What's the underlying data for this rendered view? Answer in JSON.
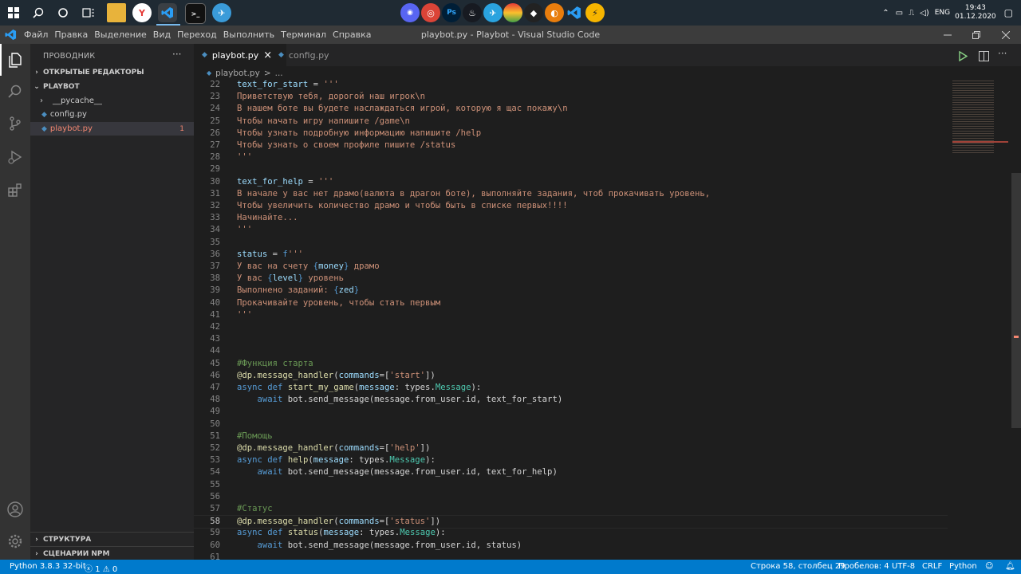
{
  "taskbar": {
    "clock_time": "19:43",
    "clock_date": "01.12.2020",
    "language": "ENG"
  },
  "window": {
    "title": "playbot.py - Playbot - Visual Studio Code",
    "menu": [
      "Файл",
      "Правка",
      "Выделение",
      "Вид",
      "Переход",
      "Выполнить",
      "Терминал",
      "Справка"
    ]
  },
  "sidebar": {
    "title": "ПРОВОДНИК",
    "more": "···",
    "open_editors": "ОТКРЫТЫЕ РЕДАКТОРЫ",
    "project": "PLAYBOT",
    "items": [
      {
        "label": "__pycache__"
      },
      {
        "label": "config.py"
      },
      {
        "label": "playbot.py",
        "badge": "1"
      }
    ],
    "outline": "СТРУКТУРА",
    "npm": "СЦЕНАРИИ NPM"
  },
  "tabs": [
    {
      "label": "playbot.py",
      "close": "×"
    },
    {
      "label": "config.py"
    }
  ],
  "breadcrumb": {
    "file": "playbot.py",
    "sep": ">",
    "rest": "..."
  },
  "editor": {
    "lines": [
      {
        "n": "22",
        "t": [
          [
            "v",
            "text_for_start"
          ],
          [
            "p",
            " = "
          ],
          [
            "s",
            "'''"
          ]
        ]
      },
      {
        "n": "23",
        "t": [
          [
            "s",
            "Приветствую тебя, дорогой наш игрок\\n"
          ]
        ]
      },
      {
        "n": "24",
        "t": [
          [
            "s",
            "В нашем боте вы будете наслаждаться игрой, которую я щас покажу\\n"
          ]
        ]
      },
      {
        "n": "25",
        "t": [
          [
            "s",
            "Чтобы начать игру напишите /game\\n"
          ]
        ]
      },
      {
        "n": "26",
        "t": [
          [
            "s",
            "Чтобы узнать подробную информацию напишите /help"
          ]
        ]
      },
      {
        "n": "27",
        "t": [
          [
            "s",
            "Чтобы узнать о своем профиле пишите /status"
          ]
        ]
      },
      {
        "n": "28",
        "t": [
          [
            "s",
            "'''"
          ]
        ]
      },
      {
        "n": "29",
        "t": []
      },
      {
        "n": "30",
        "t": [
          [
            "v",
            "text_for_help"
          ],
          [
            "p",
            " = "
          ],
          [
            "s",
            "'''"
          ]
        ]
      },
      {
        "n": "31",
        "t": [
          [
            "s",
            "В начале у вас нет драмо(валюта в драгон боте), выполняйте задания, чтоб прокачивать уровень,"
          ]
        ]
      },
      {
        "n": "32",
        "t": [
          [
            "s",
            "Чтобы увеличить количество драмо и чтобы быть в списке первых!!!!"
          ]
        ]
      },
      {
        "n": "33",
        "t": [
          [
            "s",
            "Начинайте..."
          ]
        ]
      },
      {
        "n": "34",
        "t": [
          [
            "s",
            "'''"
          ]
        ]
      },
      {
        "n": "35",
        "t": []
      },
      {
        "n": "36",
        "t": [
          [
            "v",
            "status"
          ],
          [
            "p",
            " = "
          ],
          [
            "k",
            "f"
          ],
          [
            "s",
            "'''"
          ]
        ]
      },
      {
        "n": "37",
        "t": [
          [
            "s",
            "У вас на счету "
          ],
          [
            "k",
            "{"
          ],
          [
            "v",
            "money"
          ],
          [
            "k",
            "}"
          ],
          [
            "s",
            " драмо"
          ]
        ]
      },
      {
        "n": "38",
        "t": [
          [
            "s",
            "У вас "
          ],
          [
            "k",
            "{"
          ],
          [
            "v",
            "level"
          ],
          [
            "k",
            "}"
          ],
          [
            "s",
            " уровень"
          ]
        ]
      },
      {
        "n": "39",
        "t": [
          [
            "s",
            "Выполнено заданий: "
          ],
          [
            "k",
            "{"
          ],
          [
            "v",
            "zed"
          ],
          [
            "k",
            "}"
          ]
        ]
      },
      {
        "n": "40",
        "t": [
          [
            "s",
            "Прокачивайте уровень, чтобы стать первым"
          ]
        ]
      },
      {
        "n": "41",
        "t": [
          [
            "s",
            "'''"
          ]
        ]
      },
      {
        "n": "42",
        "t": []
      },
      {
        "n": "43",
        "t": []
      },
      {
        "n": "44",
        "t": []
      },
      {
        "n": "45",
        "t": [
          [
            "c",
            "#Функция старта"
          ]
        ]
      },
      {
        "n": "46",
        "t": [
          [
            "f",
            "@dp.message_handler"
          ],
          [
            "p",
            "("
          ],
          [
            "v",
            "commands"
          ],
          [
            "p",
            "=["
          ],
          [
            "s",
            "'start'"
          ],
          [
            "p",
            "])"
          ]
        ]
      },
      {
        "n": "47",
        "t": [
          [
            "k",
            "async"
          ],
          [
            "p",
            " "
          ],
          [
            "k",
            "def"
          ],
          [
            "p",
            " "
          ],
          [
            "f",
            "start_my_game"
          ],
          [
            "p",
            "("
          ],
          [
            "v",
            "message"
          ],
          [
            "p",
            ": "
          ],
          [
            "w",
            "types"
          ],
          [
            "p",
            "."
          ],
          [
            "t",
            "Message"
          ],
          [
            "p",
            "):"
          ]
        ]
      },
      {
        "n": "48",
        "t": [
          [
            "p",
            "    "
          ],
          [
            "k",
            "await"
          ],
          [
            "p",
            " bot.send_message(message.from_user.id, text_for_start)"
          ]
        ]
      },
      {
        "n": "49",
        "t": []
      },
      {
        "n": "50",
        "t": []
      },
      {
        "n": "51",
        "t": [
          [
            "c",
            "#Помощь"
          ]
        ]
      },
      {
        "n": "52",
        "t": [
          [
            "f",
            "@dp.message_handler"
          ],
          [
            "p",
            "("
          ],
          [
            "v",
            "commands"
          ],
          [
            "p",
            "=["
          ],
          [
            "s",
            "'help'"
          ],
          [
            "p",
            "])"
          ]
        ]
      },
      {
        "n": "53",
        "t": [
          [
            "k",
            "async"
          ],
          [
            "p",
            " "
          ],
          [
            "k",
            "def"
          ],
          [
            "p",
            " "
          ],
          [
            "f",
            "help"
          ],
          [
            "p",
            "("
          ],
          [
            "v",
            "message"
          ],
          [
            "p",
            ": "
          ],
          [
            "w",
            "types"
          ],
          [
            "p",
            "."
          ],
          [
            "t",
            "Message"
          ],
          [
            "p",
            "):"
          ]
        ]
      },
      {
        "n": "54",
        "t": [
          [
            "p",
            "    "
          ],
          [
            "k",
            "await"
          ],
          [
            "p",
            " bot.send_message(message.from_user.id, text_for_help)"
          ]
        ]
      },
      {
        "n": "55",
        "t": []
      },
      {
        "n": "56",
        "t": []
      },
      {
        "n": "57",
        "t": [
          [
            "c",
            "#Статус"
          ]
        ]
      },
      {
        "n": "58",
        "t": [
          [
            "f",
            "@dp.message_handler"
          ],
          [
            "p",
            "("
          ],
          [
            "v",
            "commands"
          ],
          [
            "p",
            "=["
          ],
          [
            "s",
            "'status'"
          ],
          [
            "p",
            "])"
          ]
        ],
        "current": true
      },
      {
        "n": "59",
        "t": [
          [
            "k",
            "async"
          ],
          [
            "p",
            " "
          ],
          [
            "k",
            "def"
          ],
          [
            "p",
            " "
          ],
          [
            "f",
            "status"
          ],
          [
            "p",
            "("
          ],
          [
            "v",
            "message"
          ],
          [
            "p",
            ": "
          ],
          [
            "w",
            "types"
          ],
          [
            "p",
            "."
          ],
          [
            "t",
            "Message"
          ],
          [
            "p",
            "):"
          ]
        ]
      },
      {
        "n": "60",
        "t": [
          [
            "p",
            "    "
          ],
          [
            "k",
            "await"
          ],
          [
            "p",
            " bot.send_message(message.from_user.id, status)"
          ]
        ]
      },
      {
        "n": "61",
        "t": []
      }
    ]
  },
  "statusbar": {
    "interpreter": "Python 3.8.3 32-bit",
    "errors": "1",
    "warnings": "0",
    "position": "Строка 58, столбец 29",
    "spaces": "Пробелов: 4",
    "encoding": "UTF-8",
    "eol": "CRLF",
    "language": "Python"
  },
  "colors": {
    "accent": "#007acc",
    "string": "#ce9178",
    "keyword": "#569cd6",
    "function": "#dcdcaa",
    "variable": "#9cdcfe",
    "comment": "#6a9955",
    "error": "#f48771"
  }
}
